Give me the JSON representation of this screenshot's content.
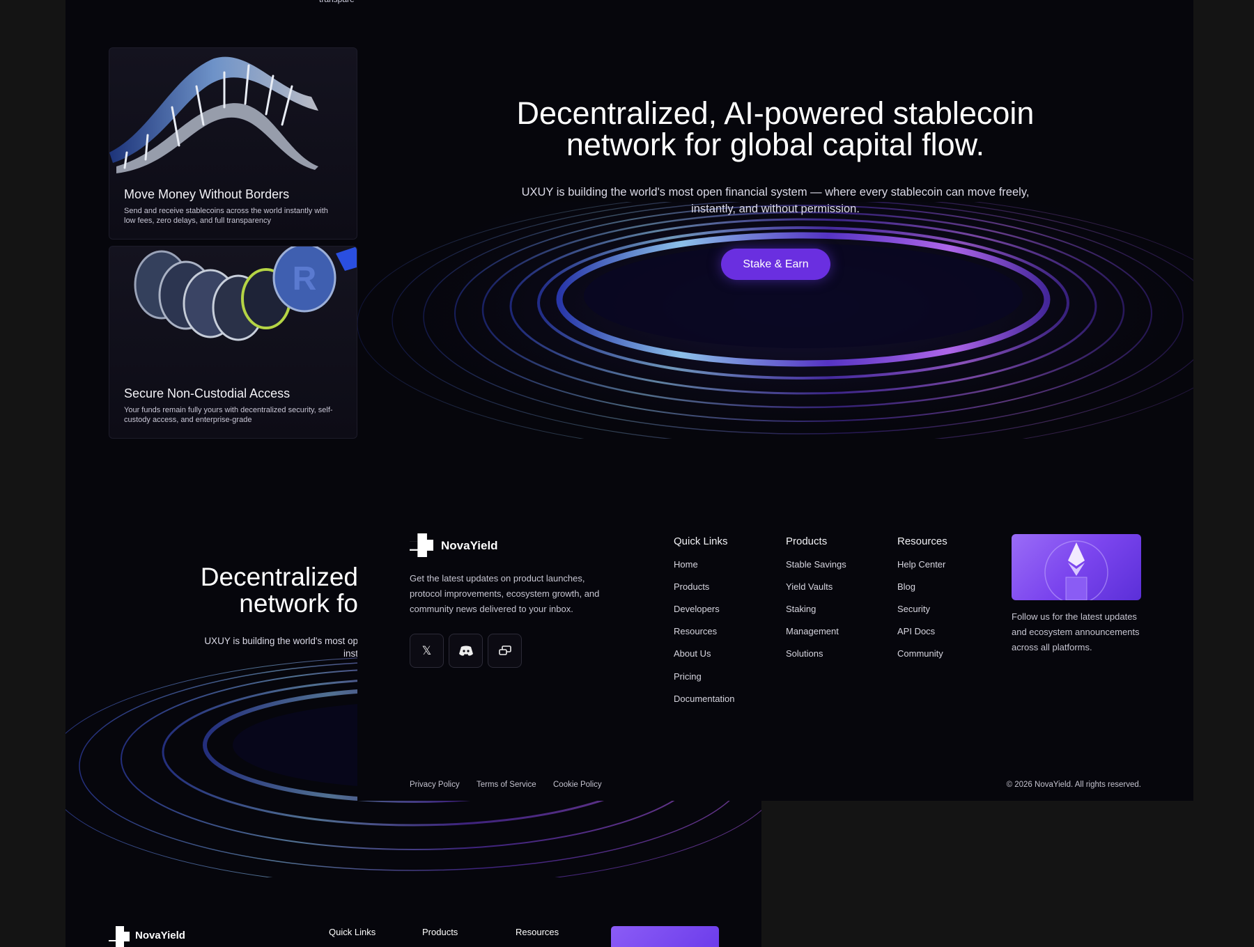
{
  "hero": {
    "title_line1": "Decentralized, AI-powered stablecoin",
    "title_line2": "network for global capital flow.",
    "subtitle_line1": "UXUY is building the world's most open financial system — where every stablecoin can move freely,",
    "subtitle_line2": "instantly, and without permission.",
    "cta_label": "Stake & Earn",
    "partial_title_line1": "Decentralized",
    "partial_title_line2": "network fo",
    "partial_subtitle_line1": "UXUY is building the world's most op",
    "partial_subtitle_line2": "inst",
    "top_fragment": "transpare"
  },
  "cards": [
    {
      "title": "Move Money Without Borders",
      "description": "Send and receive stablecoins across the world instantly with low fees, zero delays, and full transparency",
      "image": "dna-ribbon-illustration"
    },
    {
      "title": "Secure Non-Custodial Access",
      "description": "Your funds remain fully yours with decentralized security, self-custody access, and enterprise-grade",
      "image": "coins-stack-illustration"
    }
  ],
  "footer": {
    "brand": "NovaYield",
    "newsletter_text": "Get the latest updates on product launches, protocol improvements, ecosystem growth, and community news delivered to your inbox.",
    "social_icons": [
      "x-icon",
      "discord-icon",
      "chat-icon"
    ],
    "columns": [
      {
        "heading": "Quick Links",
        "links": [
          "Home",
          "Products",
          "Developers",
          "Resources",
          "About Us",
          "Pricing",
          "Documentation"
        ]
      },
      {
        "heading": "Products",
        "links": [
          "Stable Savings",
          "Yield Vaults",
          "Staking",
          "Management",
          "Solutions"
        ]
      },
      {
        "heading": "Resources",
        "links": [
          "Help Center",
          "Blog",
          "Security",
          "API Docs",
          "Community"
        ]
      }
    ],
    "promo_text": "Follow us for the latest updates and ecosystem announcements across all platforms.",
    "legal_links": [
      "Privacy Policy",
      "Terms of Service",
      "Cookie Policy"
    ],
    "copyright": "© 2026 NovaYield. All rights reserved."
  },
  "colors": {
    "background": "#06060c",
    "accent": "#6a2fe0",
    "page": "#141414"
  }
}
